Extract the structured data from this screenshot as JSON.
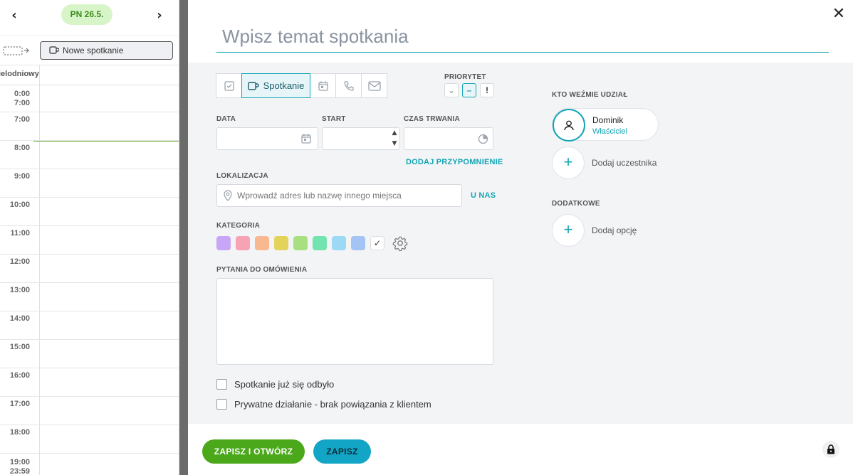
{
  "calendar": {
    "date_label": "PN 26.5.",
    "new_meeting_label": "Nowe spotkanie",
    "header_label": "ielodniowy",
    "hours": [
      {
        "label": "0:00\n7:00"
      },
      {
        "label": "7:00"
      },
      {
        "label": "8:00"
      },
      {
        "label": "9:00"
      },
      {
        "label": "10:00"
      },
      {
        "label": "11:00"
      },
      {
        "label": "12:00"
      },
      {
        "label": "13:00"
      },
      {
        "label": "14:00"
      },
      {
        "label": "15:00"
      },
      {
        "label": "16:00"
      },
      {
        "label": "17:00"
      },
      {
        "label": "18:00"
      },
      {
        "label": "19:00\n23:59"
      }
    ]
  },
  "form": {
    "subject_placeholder": "Wpisz temat spotkania",
    "types": {
      "active_label": "Spotkanie"
    },
    "priority_label": "PRIORYTET",
    "priority_options": [
      "⌄",
      "–",
      "!"
    ],
    "date_label": "DATA",
    "start_label": "START",
    "duration_label": "CZAS TRWANIA",
    "add_reminder": "DODAJ PRZYPOMNIENIE",
    "location_label": "LOKALIZACJA",
    "location_placeholder": "Wprowadź adres lub nazwę innego miejsca",
    "at_us": "U NAS",
    "category_label": "KATEGORIA",
    "category_colors": [
      "#c9a5f7",
      "#f5a3b5",
      "#f9b88f",
      "#e3d35a",
      "#a8e07f",
      "#73e3b0",
      "#9bd9f5",
      "#a3c4f5"
    ],
    "questions_label": "PYTANIA DO OMÓWIENIA",
    "checkbox_held": "Spotkanie już się odbyło",
    "checkbox_private": "Prywatne działanie - brak powiązania z klientem"
  },
  "participants": {
    "section_label": "KTO WEŹMIE UDZIAŁ",
    "person_name": "Dominik",
    "person_role": "Właściciel",
    "add_participant": "Dodaj uczestnika",
    "extra_label": "DODATKOWE",
    "add_option": "Dodaj opcję"
  },
  "footer": {
    "save_open": "ZAPISZ I OTWÓRZ",
    "save": "ZAPISZ"
  },
  "colors": {
    "accent": "#13a5b5",
    "save_open_bg": "#4aa81a",
    "save_bg": "#13a5c5",
    "date_pill_bg": "#d8f5c9"
  }
}
